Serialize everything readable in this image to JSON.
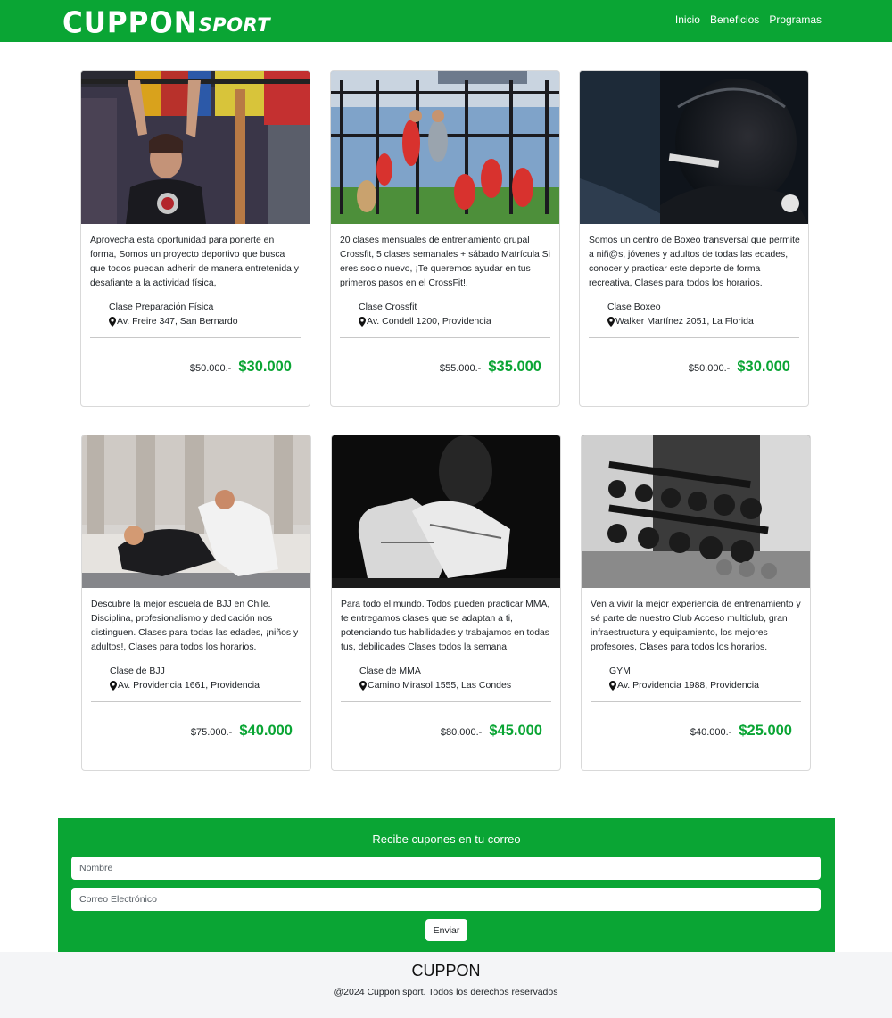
{
  "brand": {
    "main": "CUPPON",
    "sub": "SPORT"
  },
  "nav": [
    "Inicio",
    "Beneficios",
    "Programas"
  ],
  "cards": [
    {
      "description": "Aprovecha esta oportunidad para ponerte en forma, Somos un proyecto deportivo que busca que todos puedan adherir de manera entretenida y desafiante a la actividad física,",
      "class_name": "Clase Preparación Física",
      "address": "Av. Freire 347, San Bernardo",
      "old_price": "$50.000.-",
      "new_price": "$30.000",
      "image": "woman-pullup-gym-photo"
    },
    {
      "description": "20 clases mensuales de entrenamiento grupal Crossfit, 5 clases semanales + sábado Matrícula Si eres socio nuevo, ¡Te queremos ayudar en tus primeros pasos en el CrossFit!.",
      "class_name": "Clase Crossfit",
      "address": "Av. Condell 1200, Providencia",
      "old_price": "$55.000.-",
      "new_price": "$35.000",
      "image": "crossfit-group-photo"
    },
    {
      "description": "Somos un centro de Boxeo transversal que permite a niñ@s, jóvenes y adultos de todas las edades, conocer y practicar este deporte de forma recreativa, Clases para todos los horarios.",
      "class_name": "Clase Boxeo",
      "address": "Walker Martínez 2051, La Florida",
      "old_price": "$50.000.-",
      "new_price": "$30.000",
      "image": "boxing-glove-photo"
    },
    {
      "description": "Descubre la mejor escuela de BJJ en Chile. Disciplina, profesionalismo y dedicación nos distinguen. Clases para todas las edades, ¡niños y adultos!, Clases para todos los horarios.",
      "class_name": "Clase de BJJ",
      "address": "Av. Providencia 1661, Providencia",
      "old_price": "$75.000.-",
      "new_price": "$40.000",
      "image": "bjj-fighters-photo"
    },
    {
      "description": "Para todo el mundo. Todos pueden practicar MMA, te entregamos clases que se adaptan a ti, potenciando tus habilidades y trabajamos en todas tus, debilidades Clases todos la semana.",
      "class_name": "Clase de MMA",
      "address": "Camino Mirasol 1555, Las Condes",
      "old_price": "$80.000.-",
      "new_price": "$45.000",
      "image": "mma-gloves-photo"
    },
    {
      "description": "Ven a vivir la mejor experiencia de entrenamiento y sé parte de nuestro Club Acceso multiclub, gran infraestructura y equipamiento, los mejores profesores, Clases para todos los horarios.",
      "class_name": "GYM",
      "address": "Av. Providencia 1988, Providencia",
      "old_price": "$40.000.-",
      "new_price": "$25.000",
      "image": "dumbbell-rack-photo"
    }
  ],
  "newsletter": {
    "title": "Recibe cupones en tu correo",
    "name_placeholder": "Nombre",
    "email_placeholder": "Correo Electrónico",
    "submit_label": "Enviar"
  },
  "footer": {
    "brand": "CUPPON",
    "copyright": "@2024 Cuppon sport. Todos los derechos reservados"
  },
  "colors": {
    "primary": "#0aa534",
    "footer_bg": "#f4f5f7"
  }
}
